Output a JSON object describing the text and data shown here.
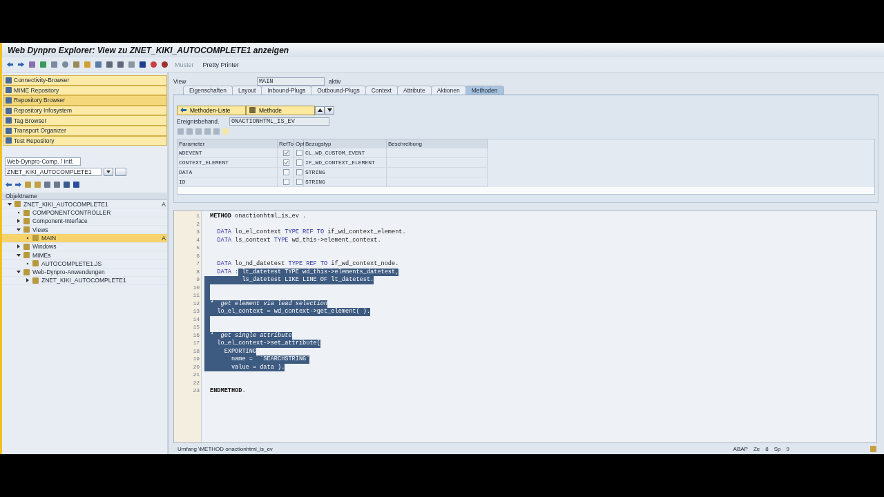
{
  "window": {
    "title": "Web Dynpro Explorer: View zu ZNET_KIKI_AUTOCOMPLETE1 anzeigen"
  },
  "toolbar": {
    "muster": {
      "label": "Muster",
      "disabled": true
    },
    "pretty_printer": {
      "label": "Pretty Printer",
      "disabled": false
    }
  },
  "navigator": [
    {
      "label": "Connectivity-Browser",
      "selected": false
    },
    {
      "label": "MIME Repository",
      "selected": false
    },
    {
      "label": "Repository Browser",
      "selected": true
    },
    {
      "label": "Repository Infosystem",
      "selected": false
    },
    {
      "label": "Tag Browser",
      "selected": false
    },
    {
      "label": "Transport Organizer",
      "selected": false
    },
    {
      "label": "Test Repository",
      "selected": false
    }
  ],
  "object_type": {
    "value": "Web-Dynpro-Comp. / Intf."
  },
  "object_name": {
    "value": "ZNET_KIKI_AUTOCOMPLETE1"
  },
  "tree": {
    "columns": [
      "Objektname"
    ],
    "items": [
      {
        "label": "ZNET_KIKI_AUTOCOMPLETE1",
        "status": "A",
        "expanded": true,
        "selected": false,
        "children": [
          {
            "label": "COMPONENTCONTROLLER",
            "selected": false
          },
          {
            "label": "Component-Interface",
            "expanded": false,
            "selected": false
          },
          {
            "label": "Views",
            "expanded": true,
            "selected": false,
            "children": [
              {
                "label": "MAIN",
                "status": "A",
                "selected": true
              }
            ]
          },
          {
            "label": "Windows",
            "expanded": false,
            "selected": false
          },
          {
            "label": "MIMEs",
            "expanded": true,
            "selected": false,
            "children": [
              {
                "label": "AUTOCOMPLETE1.JS",
                "selected": false
              }
            ]
          },
          {
            "label": "Web-Dynpro-Anwendungen",
            "expanded": true,
            "selected": false,
            "children": [
              {
                "label": "ZNET_KIKI_AUTOCOMPLETE1",
                "expanded": false,
                "selected": false
              }
            ]
          }
        ]
      }
    ]
  },
  "view": {
    "label": "View",
    "value": "MAIN",
    "status": "aktiv"
  },
  "tabs": [
    {
      "label": "Eigenschaften",
      "selected": false
    },
    {
      "label": "Layout",
      "selected": false
    },
    {
      "label": "Inbound-Plugs",
      "selected": false
    },
    {
      "label": "Outbound-Plugs",
      "selected": false
    },
    {
      "label": "Context",
      "selected": false
    },
    {
      "label": "Attribute",
      "selected": false
    },
    {
      "label": "Aktionen",
      "selected": false
    },
    {
      "label": "Methoden",
      "selected": true
    }
  ],
  "method_buttons": [
    "Methoden-Liste",
    "Methode"
  ],
  "event_handler": {
    "label": "Ereignisbehand.",
    "value": "ONACTIONHTML_IS_EV"
  },
  "parameters": {
    "columns": [
      "Parameter",
      "RefTo",
      "Opt",
      "Bezugstyp",
      "Beschreibung"
    ],
    "rows": [
      {
        "name": "WDEVENT",
        "ref_to": true,
        "opt": false,
        "type": "CL_WD_CUSTOM_EVENT"
      },
      {
        "name": "CONTEXT_ELEMENT",
        "ref_to": true,
        "opt": false,
        "type": "IF_WD_CONTEXT_ELEMENT"
      },
      {
        "name": "DATA",
        "ref_to": false,
        "opt": false,
        "type": "STRING"
      },
      {
        "name": "ID",
        "ref_to": false,
        "opt": false,
        "type": "STRING"
      }
    ]
  },
  "code": [
    {
      "number": "1",
      "selected": false,
      "segments": [
        {
          "text": "METHOD",
          "kind": "bold",
          "selected": false
        },
        {
          "text": " onactionhtml_is_ev .",
          "kind": "plain",
          "selected": false
        }
      ]
    },
    {
      "number": "2",
      "selected": false
    },
    {
      "number": "3",
      "selected": false,
      "segments": [
        {
          "text": "  DATA",
          "kind": "keyword",
          "selected": false
        },
        {
          "text": " lo_el_context ",
          "kind": "plain",
          "selected": false
        },
        {
          "text": "TYPE REF TO",
          "kind": "keyword",
          "selected": false
        },
        {
          "text": " if_wd_context_element.",
          "kind": "plain",
          "selected": false
        }
      ]
    },
    {
      "number": "4",
      "selected": false,
      "segments": [
        {
          "text": "  DATA",
          "kind": "keyword",
          "selected": false
        },
        {
          "text": " ls_context ",
          "kind": "plain",
          "selected": false
        },
        {
          "text": "TYPE",
          "kind": "keyword",
          "selected": false
        },
        {
          "text": " wd_this->element_context.",
          "kind": "plain",
          "selected": false
        }
      ]
    },
    {
      "number": "5",
      "selected": false
    },
    {
      "number": "6",
      "selected": false
    },
    {
      "number": "7",
      "selected": false,
      "segments": [
        {
          "text": "  DATA",
          "kind": "keyword",
          "selected": false
        },
        {
          "text": " lo_nd_datetest ",
          "kind": "plain",
          "selected": false
        },
        {
          "text": "TYPE REF TO",
          "kind": "keyword",
          "selected": false
        },
        {
          "text": " if_wd_context_node.",
          "kind": "plain",
          "selected": false
        }
      ]
    },
    {
      "number": "8",
      "selected": false,
      "segments": [
        {
          "text": "  DATA :",
          "kind": "keyword",
          "selected": false
        },
        {
          "text": " lt_datetest TYPE wd_this->elements_datetest,",
          "kind": "plain",
          "selected": true
        }
      ]
    },
    {
      "number": "9",
      "selected": true,
      "segments": [
        {
          "text": "         ls_datetest LIKE LINE OF lt_datetest.",
          "kind": "plain",
          "selected": true
        }
      ]
    },
    {
      "number": "10",
      "selected": true
    },
    {
      "number": "11",
      "selected": true
    },
    {
      "number": "12",
      "selected": true,
      "segments": [
        {
          "text": "*  get element via lead selection",
          "kind": "comment",
          "selected": true
        }
      ]
    },
    {
      "number": "13",
      "selected": true,
      "segments": [
        {
          "text": "  lo_el_context = wd_context->get_element( ).",
          "kind": "plain",
          "selected": true
        }
      ]
    },
    {
      "number": "14",
      "selected": true
    },
    {
      "number": "15",
      "selected": true
    },
    {
      "number": "16",
      "selected": true,
      "segments": [
        {
          "text": "*  get single attribute",
          "kind": "comment",
          "selected": true
        }
      ]
    },
    {
      "number": "17",
      "selected": true,
      "segments": [
        {
          "text": "  lo_el_context->set_attribute(",
          "kind": "plain",
          "selected": true
        }
      ]
    },
    {
      "number": "18",
      "selected": true,
      "segments": [
        {
          "text": "    EXPORTING",
          "kind": "plain",
          "selected": true
        }
      ]
    },
    {
      "number": "19",
      "selected": true,
      "segments": [
        {
          "text": "      name =  `SEARCHSTRING`",
          "kind": "plain",
          "selected": true
        }
      ]
    },
    {
      "number": "20",
      "selected": true,
      "segments": [
        {
          "text": "      value = data ).",
          "kind": "plain",
          "selected": true
        }
      ]
    },
    {
      "number": "21",
      "selected": false
    },
    {
      "number": "22",
      "selected": false
    },
    {
      "number": "23",
      "selected": false,
      "segments": [
        {
          "text": "ENDMETHOD",
          "kind": "bold",
          "selected": false
        },
        {
          "text": ".",
          "kind": "plain",
          "selected": false
        }
      ]
    }
  ],
  "status_bar": {
    "scope": "Umfang \\METHOD onactionhtml_is_ev",
    "language": "ABAP",
    "line_label": "Ze",
    "line": "8",
    "column_label": "Sp",
    "column": "9"
  }
}
